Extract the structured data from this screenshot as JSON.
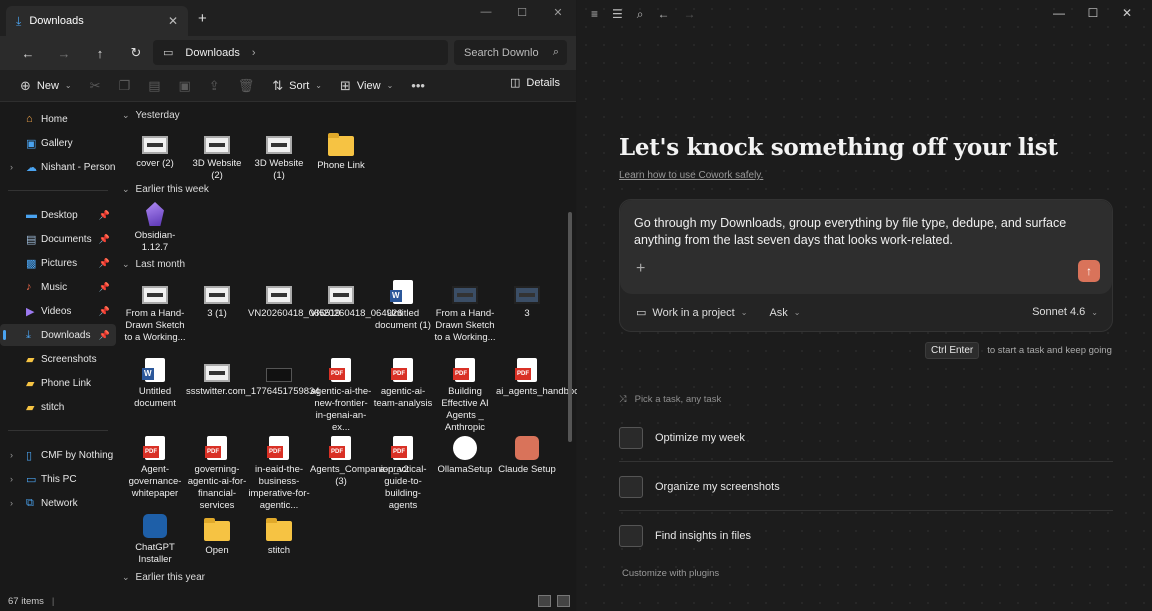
{
  "explorer": {
    "tab_title": "Downloads",
    "breadcrumb": "Downloads",
    "search_placeholder": "Search Downlo",
    "commands": {
      "new": "New",
      "sort": "Sort",
      "view": "View",
      "details": "Details"
    },
    "sidebar": [
      {
        "label": "Home",
        "icon": "home-icon"
      },
      {
        "label": "Gallery",
        "icon": "gallery-icon"
      },
      {
        "label": "Nishant - Personal",
        "icon": "cloud-icon"
      },
      {
        "label": "Desktop",
        "icon": "desktop-icon"
      },
      {
        "label": "Documents",
        "icon": "documents-icon"
      },
      {
        "label": "Pictures",
        "icon": "pictures-icon"
      },
      {
        "label": "Music",
        "icon": "music-icon"
      },
      {
        "label": "Videos",
        "icon": "videos-icon"
      },
      {
        "label": "Downloads",
        "icon": "downloads-icon"
      },
      {
        "label": "Screenshots",
        "icon": "folder-icon"
      },
      {
        "label": "Phone Link",
        "icon": "folder-icon"
      },
      {
        "label": "stitch",
        "icon": "folder-icon"
      },
      {
        "label": "CMF by Nothing P",
        "icon": "phone-icon"
      },
      {
        "label": "This PC",
        "icon": "pc-icon"
      },
      {
        "label": "Network",
        "icon": "network-icon"
      }
    ],
    "groups": {
      "yesterday": "Yesterday",
      "earlier_week": "Earlier this week",
      "last_month": "Last month",
      "earlier_year": "Earlier this year"
    },
    "files": {
      "f1": "cover (2)",
      "f2": "3D Website (2)",
      "f3": "3D Website (1)",
      "f4": "Phone Link",
      "f5": "Obsidian-1.12.7",
      "f6": "From a Hand-Drawn Sketch to a Working...",
      "f7": "3 (1)",
      "f8": "VN20260418_065519",
      "f9": "VN20260418_064926",
      "f10": "Untitled document (1)",
      "f11": "From a Hand-Drawn Sketch to a Working...",
      "f12": "3",
      "f13": "Untitled document",
      "f14": "ssstwitter.com_1776451759834",
      "f15": ".",
      "f16": "agentic-ai-the-new-frontier-in-genai-an-ex...",
      "f17": "agentic-ai-team-analysis",
      "f18": "Building Effective AI Agents _ Anthropic",
      "f19": "ai_agents_handbook",
      "f20": "Agent-governance-whitepaper",
      "f21": "governing-agentic-ai-for-financial-services",
      "f22": "in-eaid-the-business-imperative-for-agentic...",
      "f23": "Agents_Companion_v2 (3)",
      "f24": "a-practical-guide-to-building-agents",
      "f25": "OllamaSetup",
      "f26": "Claude Setup",
      "f27": "ChatGPT Installer",
      "f28": "Open",
      "f29": "stitch"
    },
    "status": "67 items"
  },
  "cowork": {
    "headline": "Let's knock something off your list",
    "learn_link": "Learn how to use Cowork safely.",
    "prompt": "Go through my Downloads, group everything by file type, dedupe, and surface anything from the last seven days that looks work-related.",
    "project_label": "Work in a project",
    "mode_label": "Ask",
    "model_label": "Sonnet 4.6",
    "shortcut_keys": "Ctrl Enter",
    "shortcut_hint": "to start a task and keep going",
    "pick_label": "Pick a task, any task",
    "tasks": [
      "Optimize my week",
      "Organize my screenshots",
      "Find insights in files"
    ],
    "customize": "Customize with plugins",
    "accent": "#d9735a"
  }
}
